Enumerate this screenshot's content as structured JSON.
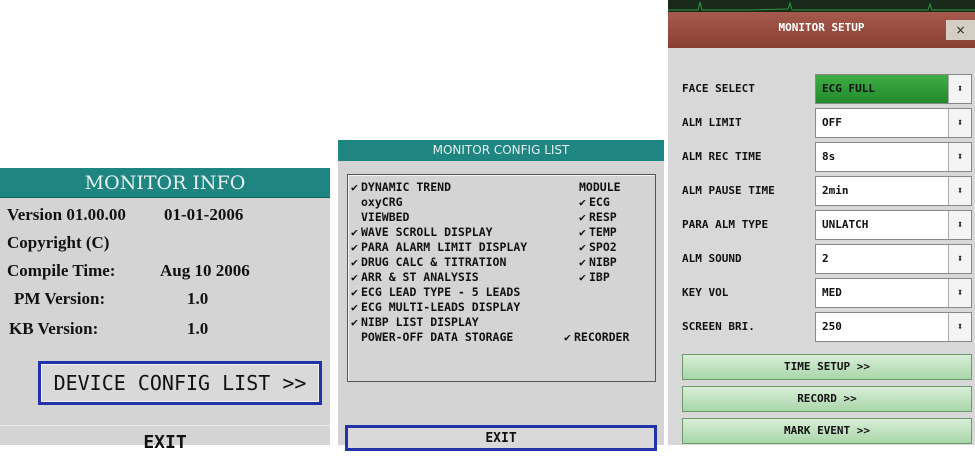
{
  "monitor_info": {
    "title": "MONITOR INFO",
    "version_label": "Version 01.00.00",
    "version_date": "01-01-2006",
    "copyright": "Copyright (C)",
    "compile_label": "Compile Time:",
    "compile_value": "Aug 10 2006",
    "pm_label": "PM Version:",
    "pm_value": "1.0",
    "kb_label": "KB Version:",
    "kb_value": "1.0",
    "device_config_button": "DEVICE CONFIG LIST >>",
    "exit_button": "EXIT"
  },
  "config_list": {
    "title": "MONITOR CONFIG LIST",
    "left_items": [
      {
        "checked": true,
        "label": "DYNAMIC TREND"
      },
      {
        "checked": false,
        "label": "oxyCRG"
      },
      {
        "checked": false,
        "label": "VIEWBED"
      },
      {
        "checked": true,
        "label": "WAVE SCROLL DISPLAY"
      },
      {
        "checked": true,
        "label": "PARA ALARM LIMIT DISPLAY"
      },
      {
        "checked": true,
        "label": "DRUG CALC & TITRATION"
      },
      {
        "checked": true,
        "label": "ARR & ST ANALYSIS"
      },
      {
        "checked": true,
        "label": "ECG LEAD TYPE - 5 LEADS"
      },
      {
        "checked": true,
        "label": "ECG MULTI-LEADS DISPLAY"
      },
      {
        "checked": true,
        "label": "NIBP LIST DISPLAY"
      },
      {
        "checked": false,
        "label": "POWER-OFF DATA STORAGE"
      }
    ],
    "module_header": "MODULE",
    "modules": [
      {
        "checked": true,
        "label": "ECG"
      },
      {
        "checked": true,
        "label": "RESP"
      },
      {
        "checked": true,
        "label": "TEMP"
      },
      {
        "checked": true,
        "label": "SPO2"
      },
      {
        "checked": true,
        "label": "NIBP"
      },
      {
        "checked": true,
        "label": "IBP"
      }
    ],
    "recorder": {
      "checked": true,
      "label": "RECORDER"
    },
    "exit_button": "EXIT"
  },
  "monitor_setup": {
    "title": "MONITOR SETUP",
    "close": "×",
    "fields": [
      {
        "label": "FACE SELECT",
        "value": "ECG FULL",
        "highlight": true
      },
      {
        "label": "ALM LIMIT",
        "value": "OFF",
        "highlight": false
      },
      {
        "label": "ALM REC TIME",
        "value": "8s",
        "highlight": false
      },
      {
        "label": "ALM PAUSE TIME",
        "value": "2min",
        "highlight": false
      },
      {
        "label": "PARA ALM TYPE",
        "value": "UNLATCH",
        "highlight": false
      },
      {
        "label": "ALM SOUND",
        "value": "2",
        "highlight": false
      },
      {
        "label": "KEY VOL",
        "value": "MED",
        "highlight": false
      },
      {
        "label": "SCREEN BRI.",
        "value": "250",
        "highlight": false
      }
    ],
    "buttons": [
      "TIME SETUP >>",
      "RECORD >>",
      "MARK EVENT >>"
    ],
    "spinner_glyph": "⬍"
  },
  "colors": {
    "title_bar": "#1e8581",
    "setup_title": "#8a3f33",
    "focus_border": "#2233aa",
    "highlight_green": "#218a2c"
  }
}
